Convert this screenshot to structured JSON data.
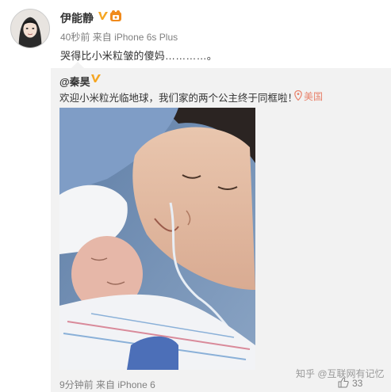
{
  "post": {
    "author": "伊能静",
    "meta_time": "40秒前",
    "meta_from_label": "来自",
    "meta_device": "iPhone 6s Plus",
    "content": "哭得比小米粒皱的傻妈…………。"
  },
  "repost": {
    "author": "@秦昊",
    "text": "欢迎小米粒光临地球，我们家的两个公主终于同框啦！",
    "location": "美国",
    "meta_time": "9分钟前",
    "meta_from_label": "来自",
    "meta_device": "iPhone 6"
  },
  "watermark": "知乎 @互联网有记忆",
  "like_count": "33",
  "colors": {
    "verified": "#f5a623",
    "location": "#e8826b",
    "meta": "#808080",
    "repost_bg": "#f2f2f2"
  },
  "icons": [
    "avatar",
    "verified-icon",
    "badge-icon",
    "location-pin-icon",
    "like-icon"
  ]
}
